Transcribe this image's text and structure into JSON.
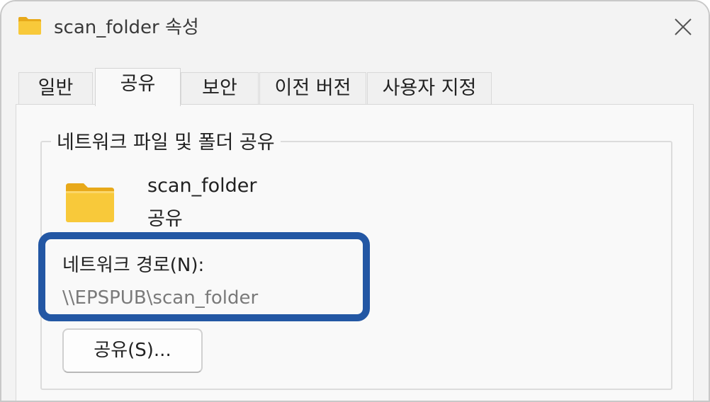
{
  "window": {
    "title": "scan_folder 속성",
    "title_icon": "folder-icon",
    "close_icon": "close-icon"
  },
  "tabs": [
    {
      "label": "일반",
      "active": false
    },
    {
      "label": "공유",
      "active": true
    },
    {
      "label": "보안",
      "active": false
    },
    {
      "label": "이전 버전",
      "active": false
    },
    {
      "label": "사용자 지정",
      "active": false
    }
  ],
  "sharing": {
    "group_title": "네트워크 파일 및 폴더 공유",
    "folder_icon": "folder-icon",
    "share_name": "scan_folder",
    "share_status": "공유",
    "network_path_label": "네트워크 경로(N):",
    "network_path_value": "\\\\EPSPUB\\scan_folder",
    "share_button_label": "공유(S)..."
  },
  "colors": {
    "highlight_border": "#2357a4",
    "folder_yellow": "#f8c93a",
    "folder_yellow_dark": "#e8a91a"
  }
}
